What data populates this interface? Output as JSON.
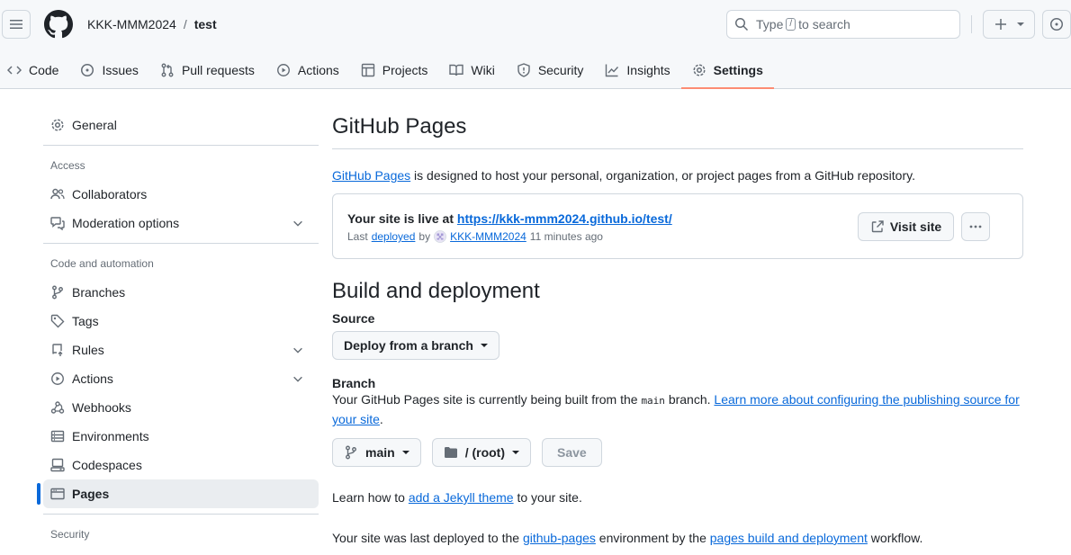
{
  "header": {
    "owner": "KKK-MMM2024",
    "separator": "/",
    "repo": "test",
    "search_prefix": "Type",
    "search_key": "/",
    "search_suffix": "to search"
  },
  "tabs": [
    {
      "label": "Code",
      "icon": "code-icon"
    },
    {
      "label": "Issues",
      "icon": "issue-icon"
    },
    {
      "label": "Pull requests",
      "icon": "pull-request-icon"
    },
    {
      "label": "Actions",
      "icon": "play-icon"
    },
    {
      "label": "Projects",
      "icon": "table-icon"
    },
    {
      "label": "Wiki",
      "icon": "book-icon"
    },
    {
      "label": "Security",
      "icon": "shield-icon"
    },
    {
      "label": "Insights",
      "icon": "graph-icon"
    },
    {
      "label": "Settings",
      "icon": "gear-icon",
      "active": true
    }
  ],
  "sidebar": {
    "general": "General",
    "access_heading": "Access",
    "collaborators": "Collaborators",
    "moderation": "Moderation options",
    "automation_heading": "Code and automation",
    "branches": "Branches",
    "tags": "Tags",
    "rules": "Rules",
    "actions": "Actions",
    "webhooks": "Webhooks",
    "environments": "Environments",
    "codespaces": "Codespaces",
    "pages": "Pages",
    "security_heading": "Security"
  },
  "main": {
    "title": "GitHub Pages",
    "intro_link": "GitHub Pages",
    "intro_text": " is designed to host your personal, organization, or project pages from a GitHub repository.",
    "live_prefix": "Your site is live at ",
    "live_url": "https://kkk-mmm2024.github.io/test/",
    "last": "Last",
    "deployed": "deployed",
    "by": "by",
    "user": "KKK-MMM2024",
    "ago": "11 minutes ago",
    "visit_site": "Visit site",
    "build_title": "Build and deployment",
    "source_label": "Source",
    "source_value": "Deploy from a branch",
    "branch_label": "Branch",
    "branch_text_1": "Your GitHub Pages site is currently being built from the ",
    "branch_code": "main",
    "branch_text_2": " branch. ",
    "branch_link": "Learn more about configuring the publishing source for your site",
    "branch_end": ".",
    "branch_select": "main",
    "folder_select": "/ (root)",
    "save": "Save",
    "jekyll_1": "Learn how to ",
    "jekyll_link": "add a Jekyll theme",
    "jekyll_2": " to your site.",
    "deployed_1": "Your site was last deployed to the ",
    "deployed_env": "github-pages",
    "deployed_2": " environment by the ",
    "deployed_workflow": "pages build and deployment",
    "deployed_3": " workflow."
  }
}
